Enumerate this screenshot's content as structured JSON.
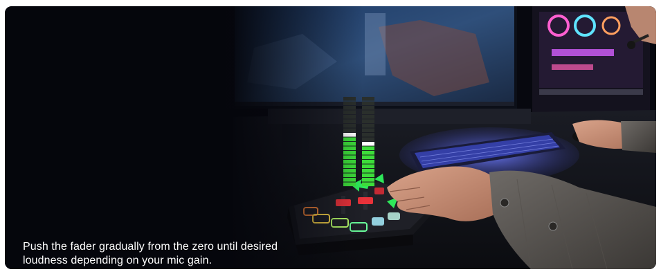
{
  "caption": {
    "line1": "Push the fader gradually from the zero until desired",
    "line2": "loudness depending on your mic gain."
  },
  "level_meters": {
    "left_level": 0.55,
    "right_level": 0.45,
    "segments": 20
  },
  "colors": {
    "background": "#05060c",
    "meter_green": "#3ddc3a",
    "meter_peak": "#ffffff",
    "keyboard_glow": "#5a6bff",
    "arrow_green": "#2ee85a"
  }
}
